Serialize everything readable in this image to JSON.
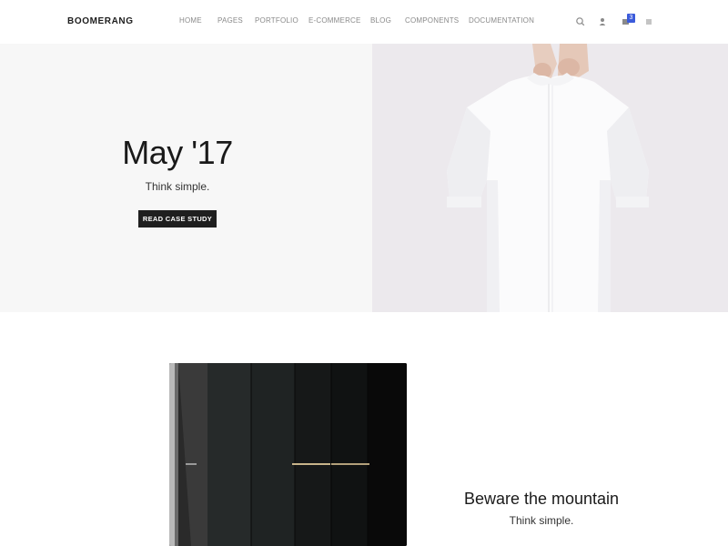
{
  "brand": {
    "name": "BOOMERANG"
  },
  "nav": {
    "items": [
      "HOME",
      "PAGES",
      "PORTFOLIO",
      "E-COMMERCE",
      "BLOG",
      "COMPONENTS",
      "DOCUMENTATION"
    ]
  },
  "toolbar": {
    "icons": [
      "search-icon",
      "user-icon",
      "cart-icon",
      "menu-icon"
    ],
    "cart_count": "3",
    "badge_color": "#3b5bdb"
  },
  "hero": {
    "title": "May '17",
    "subtitle": "Think simple.",
    "button_label": "READ CASE STUDY"
  },
  "feature": {
    "title": "Beware the mountain",
    "subtitle": "Think simple."
  }
}
